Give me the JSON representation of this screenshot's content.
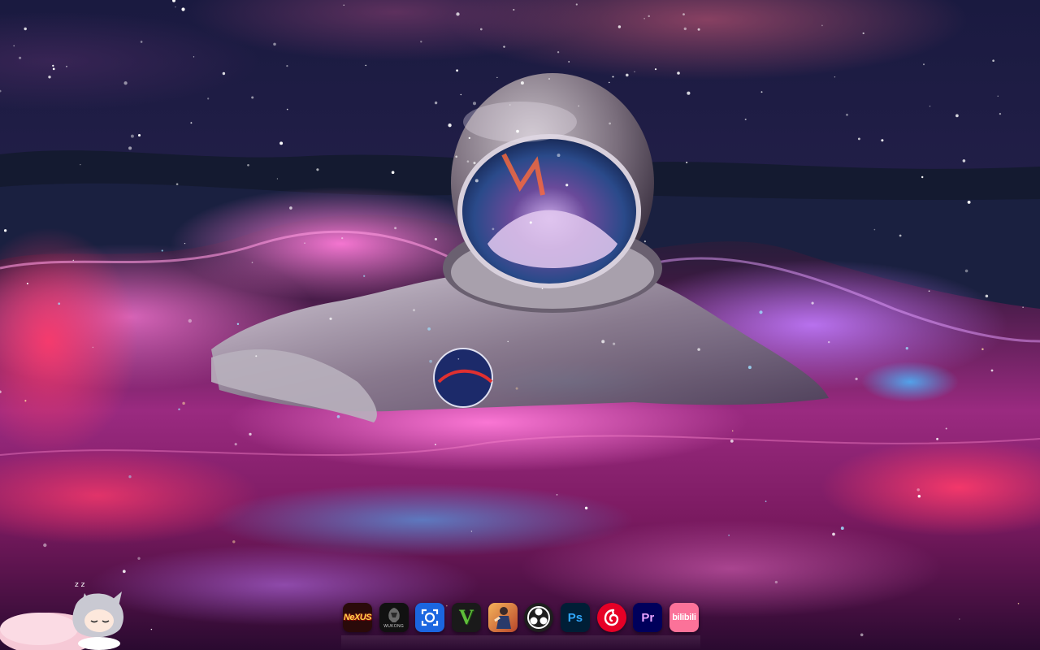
{
  "desktop": {
    "dock": {
      "apps": [
        {
          "name": "nexus",
          "label": "NeXUS",
          "icon": "nexus-icon"
        },
        {
          "name": "black-myth-wukong",
          "label": "WUKONG",
          "icon": "wukong-icon"
        },
        {
          "name": "screen-capture",
          "icon": "camera-icon"
        },
        {
          "name": "gta-v",
          "label": "V",
          "icon": "gta-v-icon"
        },
        {
          "name": "game",
          "icon": "game-character-icon"
        },
        {
          "name": "obs-studio",
          "icon": "obs-icon"
        },
        {
          "name": "photoshop",
          "label": "Ps",
          "icon": "photoshop-icon"
        },
        {
          "name": "netease-music",
          "icon": "netease-music-icon"
        },
        {
          "name": "premiere-pro",
          "label": "Pr",
          "icon": "premiere-pro-icon"
        },
        {
          "name": "bilibili",
          "label": "bilibili",
          "icon": "bilibili-icon"
        }
      ]
    },
    "pet": {
      "icon": "sleeping-anime-girl-icon"
    },
    "colors": {
      "ps_bg": "#001e36",
      "ps_text": "#31a8ff",
      "pr_bg": "#00005b",
      "pr_text": "#e8a2ff",
      "bilibili": "#fb7299",
      "netease": "#e60026"
    }
  }
}
